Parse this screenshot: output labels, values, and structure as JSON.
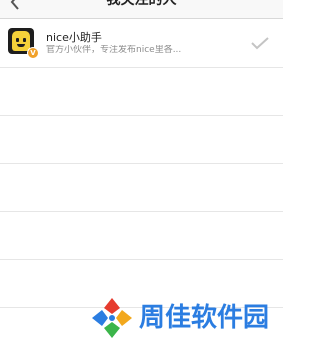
{
  "header": {
    "title": "我关注的人",
    "back_icon": "chevron-left-icon"
  },
  "follow_list": {
    "items": [
      {
        "name": "nice小助手",
        "description": "官方小伙伴，专注发布nice里各...",
        "avatar_icon": "nice-mascot-avatar",
        "badge": "V",
        "followed_icon": "checkmark-icon"
      }
    ],
    "empty_rows": 5
  },
  "watermark": {
    "text": "周佳软件园",
    "colors": [
      "#e63b2e",
      "#f2a81d",
      "#3bb54a",
      "#2b7de1"
    ]
  },
  "colors": {
    "background": "#ffffff",
    "divider": "#e6e6e6",
    "secondary_text": "#8c8c8c",
    "badge": "#f1a12a"
  }
}
